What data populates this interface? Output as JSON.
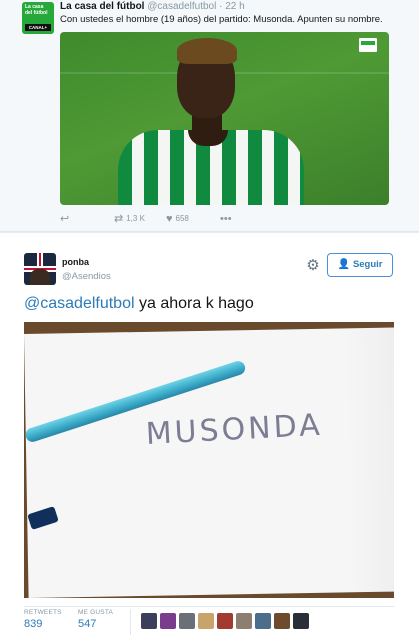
{
  "tweet_top": {
    "avatar_text": "La casa del fútbol",
    "avatar_brand": "CANAL+",
    "name": "La casa del fútbol",
    "handle": "@casadelfutbol",
    "separator": "·",
    "time": "22 h",
    "text": "Con ustedes el hombre (19 años) del partido: Musonda. Apunten su nombre.",
    "actions": {
      "reply_icon": "reply-icon",
      "retweet_icon": "retweet-icon",
      "retweet_count": "1,3 K",
      "like_icon": "heart-icon",
      "like_count": "658",
      "more_icon": "more-icon"
    }
  },
  "tweet_bottom": {
    "name": "ponba",
    "handle": "@Asendios",
    "follow_label": "Seguir",
    "mention": "@casadelfutbol",
    "text_rest": " ya ahora k hago",
    "photo_handwriting": "MUSONDA",
    "stats": {
      "retweets_label": "RETWEETS",
      "retweets_value": "839",
      "likes_label": "ME GUSTA",
      "likes_value": "547"
    },
    "liker_colors": [
      "#3b3f5c",
      "#7a3d8c",
      "#6b6f78",
      "#c9a46a",
      "#a33a2f",
      "#8d7f70",
      "#4d6e8a",
      "#6f4b2e",
      "#2a2e36"
    ]
  }
}
